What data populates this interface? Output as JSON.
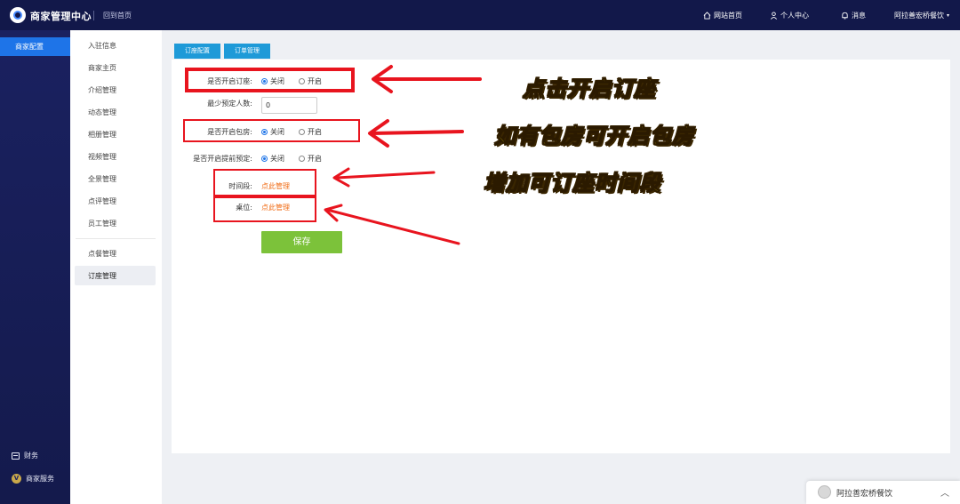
{
  "header": {
    "app_title": "商家管理中心",
    "back_home": "回到首页",
    "nav": [
      {
        "label": "网站首页",
        "icon": "home-icon"
      },
      {
        "label": "个人中心",
        "icon": "user-icon"
      },
      {
        "label": "消息",
        "icon": "bell-icon"
      },
      {
        "label": "阿拉善宏桥餐饮",
        "icon": "caret-down-icon"
      }
    ]
  },
  "sidebar": {
    "active": "商家配置",
    "bottom": [
      {
        "label": "财务",
        "icon": "wallet-icon"
      },
      {
        "label": "商家服务",
        "icon": "v-badge-icon",
        "badge": "V"
      }
    ]
  },
  "submenu": {
    "items": [
      "入驻信息",
      "商家主页",
      "介绍管理",
      "动态管理",
      "相册管理",
      "视频管理",
      "全景管理",
      "点评管理",
      "员工管理",
      "点餐管理",
      "订座管理"
    ],
    "active_index": 10
  },
  "tabs": [
    "订座配置",
    "订单管理"
  ],
  "form": {
    "enable_booking": {
      "label": "是否开启订座:",
      "options": [
        "关闭",
        "开启"
      ],
      "selected": 0
    },
    "min_people": {
      "label": "最少预定人数:",
      "value": "0"
    },
    "enable_room": {
      "label": "是否开启包房:",
      "options": [
        "关闭",
        "开启"
      ],
      "selected": 0
    },
    "enable_advance": {
      "label": "是否开启提前预定:",
      "options": [
        "关闭",
        "开启"
      ],
      "selected": 0
    },
    "time_slot": {
      "label": "时间段:",
      "link": "点此管理"
    },
    "table": {
      "label": "桌位:",
      "link": "点此管理"
    },
    "save": "保存"
  },
  "annotations": {
    "a1": "点击开启订座",
    "a2": "如有包房可开启包房",
    "a3": "增加可订座时间段",
    "color_text": "#ffe600",
    "color_marks": "#e8141e"
  },
  "chat": {
    "name": "阿拉善宏桥餐饮"
  },
  "colors": {
    "topbar": "#12184a",
    "accent": "#1e74e8",
    "tab": "#1e9ad8",
    "save": "#7cc23a",
    "link": "#f06b14"
  }
}
